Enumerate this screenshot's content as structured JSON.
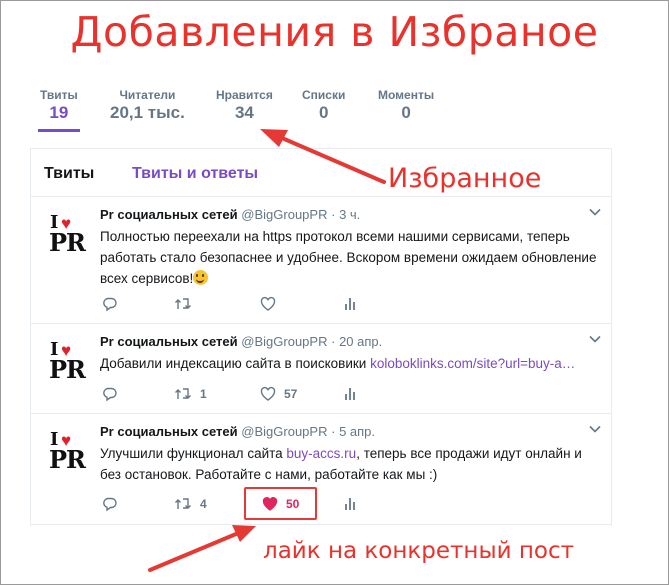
{
  "heading": "Добавления в Избраное",
  "profile_nav": [
    {
      "label": "Твиты",
      "value": "19",
      "active": true
    },
    {
      "label": "Читатели",
      "value": "20,1 тыс.",
      "active": false
    },
    {
      "label": "Нравится",
      "value": "34",
      "active": false
    },
    {
      "label": "Списки",
      "value": "0",
      "active": false
    },
    {
      "label": "Моменты",
      "value": "0",
      "active": false
    }
  ],
  "tabs": {
    "tweets": "Твиты",
    "tweets_replies": "Твиты и ответы"
  },
  "tweets": [
    {
      "name": "Pr социальных сетей",
      "handle": "@BigGroupPR",
      "sep": "·",
      "time": "3 ч.",
      "text": "Полностью переехали на https протокол всеми нашими сервисами, теперь работать стало безопаснее и удобнее. Вскором времени ожидаем обновление всех сервисов!",
      "retweets": "",
      "likes": ""
    },
    {
      "name": "Pr социальных сетей",
      "handle": "@BigGroupPR",
      "sep": "·",
      "time": "20 апр.",
      "text": "Добавили индексацию сайта в поисковики ",
      "link": "koloboklinks.com/site?url=buy-a…",
      "retweets": "1",
      "likes": "57"
    },
    {
      "name": "Pr социальных сетей",
      "handle": "@BigGroupPR",
      "sep": "·",
      "time": "5 апр.",
      "text_before": "Улучшили функционал сайта ",
      "link": "buy-accs.ru",
      "text_after": ", теперь все продажи идут онлайн и без остановок. Работайте с нами, работайте как мы :)",
      "retweets": "4",
      "likes": "50"
    }
  ],
  "avatar": {
    "line1": "I",
    "line2": "PR"
  },
  "annotations": {
    "favorites": "Избранное",
    "like_post": "лайк на конкретный пост"
  },
  "colors": {
    "accent": "#794bc4",
    "annotation": "#e8322b",
    "like": "#e0245e"
  },
  "icons": [
    "reply-icon",
    "retweet-icon",
    "like-icon",
    "analytics-icon",
    "chevron-down-icon",
    "heart-icon"
  ]
}
